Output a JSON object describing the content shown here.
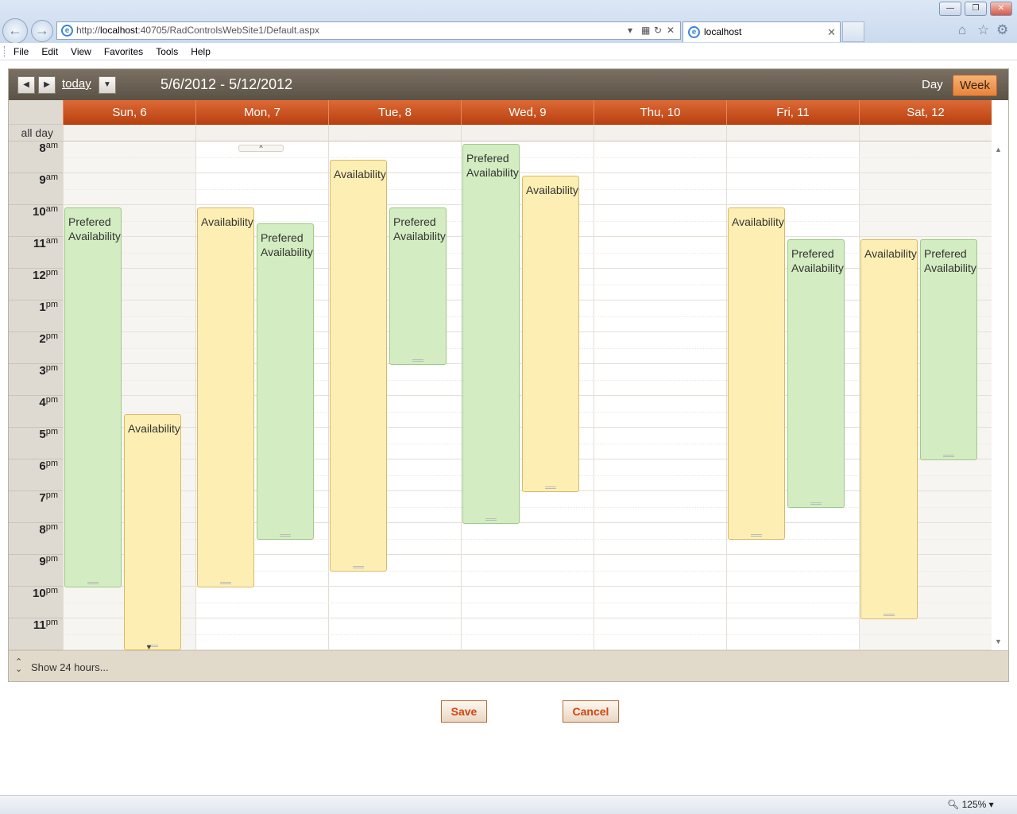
{
  "browser": {
    "url_prefix": "http://",
    "url_host": "localhost",
    "url_rest": ":40705/RadControlsWebSite1/Default.aspx",
    "tab_title": "localhost",
    "menu": [
      "File",
      "Edit",
      "View",
      "Favorites",
      "Tools",
      "Help"
    ],
    "zoom": "125%"
  },
  "scheduler": {
    "today_label": "today",
    "date_range": "5/6/2012 - 5/12/2012",
    "view_day": "Day",
    "view_week": "Week",
    "all_day_label": "all day",
    "days": [
      "Sun, 6",
      "Mon, 7",
      "Tue, 8",
      "Wed, 9",
      "Thu, 10",
      "Fri, 11",
      "Sat, 12"
    ],
    "hours": [
      {
        "h": "8",
        "m": "am"
      },
      {
        "h": "9",
        "m": "am"
      },
      {
        "h": "10",
        "m": "am"
      },
      {
        "h": "11",
        "m": "am"
      },
      {
        "h": "12",
        "m": "pm"
      },
      {
        "h": "1",
        "m": "pm"
      },
      {
        "h": "2",
        "m": "pm"
      },
      {
        "h": "3",
        "m": "pm"
      },
      {
        "h": "4",
        "m": "pm"
      },
      {
        "h": "5",
        "m": "pm"
      },
      {
        "h": "6",
        "m": "pm"
      },
      {
        "h": "7",
        "m": "pm"
      },
      {
        "h": "8",
        "m": "pm"
      },
      {
        "h": "9",
        "m": "pm"
      },
      {
        "h": "10",
        "m": "pm"
      },
      {
        "h": "11",
        "m": "pm"
      }
    ],
    "appointments": [
      {
        "day": 0,
        "slot": 0,
        "start": "10:00am",
        "end": "10:00pm",
        "subject": "Prefered Availability",
        "kind": "pref"
      },
      {
        "day": 0,
        "slot": 1,
        "start": "4:30pm",
        "end": "11:59pm",
        "subject": "Availability",
        "kind": "avail"
      },
      {
        "day": 1,
        "slot": 0,
        "start": "10:00am",
        "end": "10:00pm",
        "subject": "Availability",
        "kind": "avail"
      },
      {
        "day": 1,
        "slot": 1,
        "start": "10:30am",
        "end": "8:30pm",
        "subject": "Prefered Availability",
        "kind": "pref"
      },
      {
        "day": 2,
        "slot": 0,
        "start": "8:30am",
        "end": "9:30pm",
        "subject": "Availability",
        "kind": "avail"
      },
      {
        "day": 2,
        "slot": 1,
        "start": "10:00am",
        "end": "3:00pm",
        "subject": "Prefered Availability",
        "kind": "pref"
      },
      {
        "day": 3,
        "slot": 0,
        "start": "8:00am",
        "end": "8:00pm",
        "subject": "Prefered Availability",
        "kind": "pref"
      },
      {
        "day": 3,
        "slot": 1,
        "start": "9:00am",
        "end": "7:00pm",
        "subject": "Availability",
        "kind": "avail"
      },
      {
        "day": 5,
        "slot": 0,
        "start": "10:00am",
        "end": "8:30pm",
        "subject": "Availability",
        "kind": "avail"
      },
      {
        "day": 5,
        "slot": 1,
        "start": "11:00am",
        "end": "7:30pm",
        "subject": "Prefered Availability",
        "kind": "pref"
      },
      {
        "day": 6,
        "slot": 0,
        "start": "11:00am",
        "end": "11:00pm",
        "subject": "Availability",
        "kind": "avail"
      },
      {
        "day": 6,
        "slot": 1,
        "start": "11:00am",
        "end": "6:00pm",
        "subject": "Prefered Availability",
        "kind": "pref"
      }
    ],
    "show24_label": "Show 24 hours..."
  },
  "actions": {
    "save_label": "Save",
    "cancel_label": "Cancel"
  }
}
